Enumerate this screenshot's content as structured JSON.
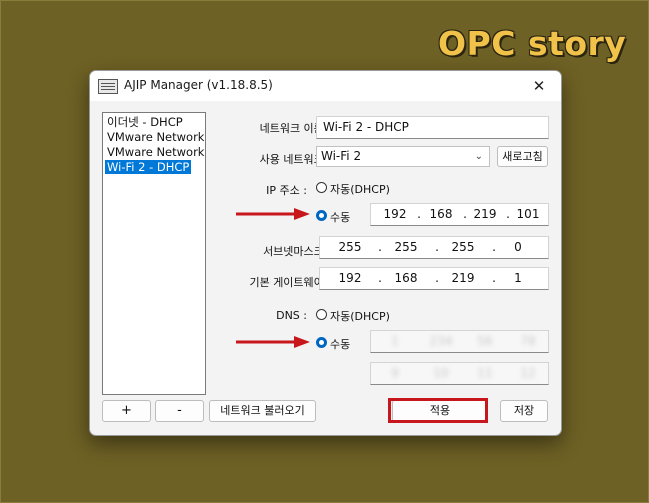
{
  "watermark": "OPC story",
  "window": {
    "title": "AJIP Manager (v1.18.8.5)",
    "close_glyph": "✕"
  },
  "network_list": [
    "이더넷 - DHCP",
    "VMware Network",
    "VMware Network",
    "Wi-Fi 2 - DHCP"
  ],
  "network_list_selected": "Wi-Fi 2 - DHCP",
  "form": {
    "network_name_label": "네트워크 이름 :",
    "network_name_value": "Wi-Fi 2 - DHCP",
    "use_network_label": "사용 네트워크 :",
    "use_network_value": "Wi-Fi 2",
    "refresh_label": "새로고침",
    "ip_label": "IP 주소 :",
    "ip_auto_label": "자동(DHCP)",
    "ip_manual_label": "수동",
    "ip_address": [
      "192",
      "168",
      "219",
      "101"
    ],
    "subnet_label": "서브넷마스크 :",
    "subnet_mask": [
      "255",
      "255",
      "255",
      "0"
    ],
    "gateway_label": "기본 게이트웨이 :",
    "gateway": [
      "192",
      "168",
      "219",
      "1"
    ],
    "dns_label": "DNS :",
    "dns_auto_label": "자동(DHCP)",
    "dns_manual_label": "수동",
    "dns_primary": [
      "1",
      "234",
      "56",
      "78"
    ],
    "dns_secondary": [
      "9",
      "10",
      "11",
      "12"
    ]
  },
  "buttons": {
    "add": "+",
    "remove": "-",
    "load_network": "네트워크 불러오기",
    "apply": "적용",
    "save": "저장"
  },
  "colors": {
    "background": "#6e6125",
    "watermark": "#f0c24a",
    "selection": "#0078d7",
    "radio_checked": "#0067c0",
    "highlight_box": "#c8161d",
    "annotation_arrow": "#c8161d"
  }
}
